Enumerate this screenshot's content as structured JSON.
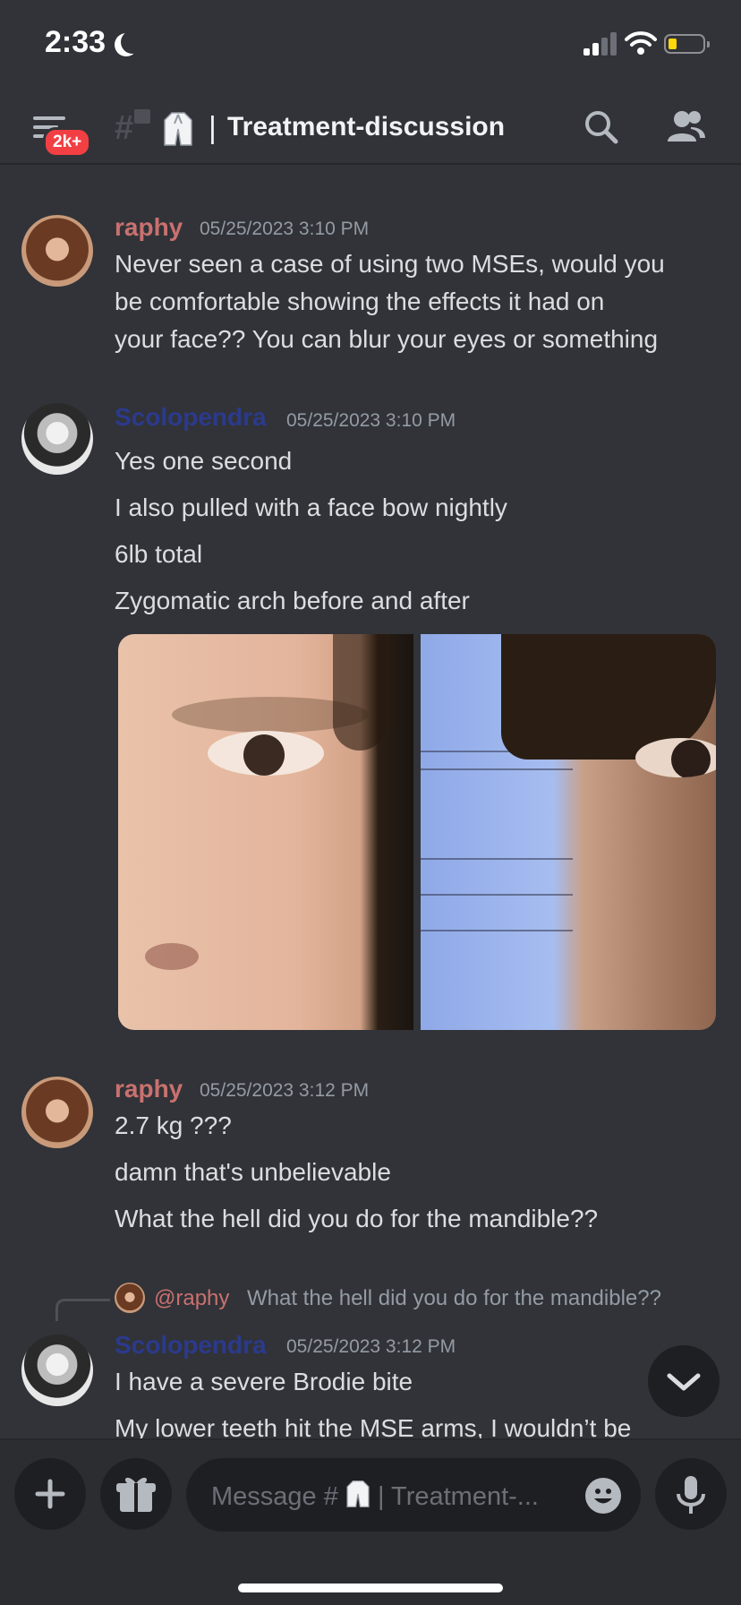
{
  "status_bar": {
    "time": "2:33"
  },
  "header": {
    "menu_badge": "2k+",
    "channel_prefix": "|",
    "channel_name": "Treatment-discussion"
  },
  "messages": [
    {
      "author": "raphy",
      "timestamp": "05/25/2023 3:10 PM",
      "lines": [
        "Never seen a case of using two MSEs, would you",
        "be comfortable showing the effects it had on",
        "your face?? You can blur your eyes or something"
      ]
    },
    {
      "author": "Scolopendra",
      "timestamp": "05/25/2023 3:10 PM",
      "lines": [
        "Yes one second",
        "I also pulled with a face bow nightly",
        "6lb total",
        "Zygomatic arch before and after"
      ]
    },
    {
      "author": "raphy",
      "timestamp": "05/25/2023 3:12 PM",
      "lines": [
        "2.7 kg ???",
        "damn that's unbelievable",
        "What the hell did you do for the mandible??"
      ]
    },
    {
      "reply_author": "@raphy",
      "reply_text": "What the hell did you do for the mandible??",
      "author": "Scolopendra",
      "timestamp": "05/25/2023 3:12 PM",
      "lines": [
        "I have a severe Brodie bite",
        "My lower teeth hit the MSE arms, I wouldn’t be"
      ]
    }
  ],
  "composer": {
    "placeholder": "Message #",
    "placeholder_suffix": "| Treatment-..."
  },
  "colors": {
    "background": "#313338",
    "raphy": "#c9716f",
    "scolopendra": "#2b3a8c",
    "badge": "#f23f43"
  },
  "icons": [
    "hamburger-icon",
    "hash-icon",
    "lock-icon",
    "lab-coat-icon",
    "search-icon",
    "members-icon",
    "chevron-down-icon",
    "plus-icon",
    "gift-icon",
    "emoji-icon",
    "microphone-icon"
  ]
}
